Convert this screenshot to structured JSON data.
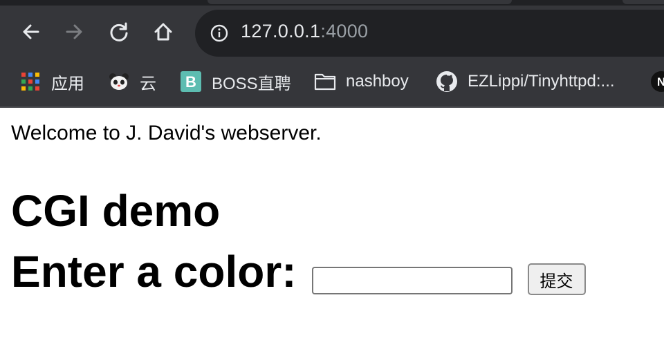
{
  "browser": {
    "url_host": "127.0.0.1",
    "url_port": ":4000"
  },
  "bookmarks": [
    {
      "label": "应用",
      "icon": "apps-grid-icon"
    },
    {
      "label": "云",
      "icon": "panda-icon"
    },
    {
      "label": "BOSS直聘",
      "icon": "boss-logo-icon"
    },
    {
      "label": "nashboy",
      "icon": "folder-icon"
    },
    {
      "label": "EZLippi/Tinyhttpd:...",
      "icon": "github-icon"
    },
    {
      "label": "N",
      "icon": "notion-icon"
    }
  ],
  "page": {
    "welcome": "Welcome to J. David's webserver.",
    "heading": "CGI demo",
    "form_label": "Enter a color:",
    "color_input_value": "",
    "submit_label": "提交"
  },
  "colors": {
    "chrome_bg": "#35363a",
    "omnibox_bg": "#202124",
    "chrome_text": "#e8eaed"
  }
}
